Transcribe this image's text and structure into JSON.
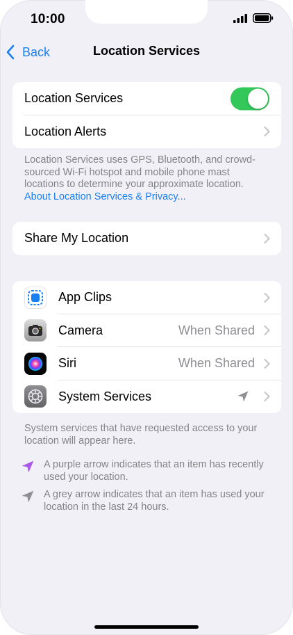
{
  "status_bar": {
    "time": "10:00"
  },
  "nav": {
    "back_label": "Back",
    "title": "Location Services"
  },
  "location_group": {
    "location_services_label": "Location Services",
    "location_services_enabled": true,
    "location_alerts_label": "Location Alerts"
  },
  "description": {
    "text": "Location Services uses GPS, Bluetooth, and crowd-sourced Wi-Fi hotspot and mobile phone mast locations to determine your approximate location.",
    "link": "About Location Services & Privacy..."
  },
  "share_group": {
    "share_my_location_label": "Share My Location"
  },
  "apps": [
    {
      "name": "App Clips",
      "value": "",
      "icon": "app-clips-icon"
    },
    {
      "name": "Camera",
      "value": "When Shared",
      "icon": "camera-icon"
    },
    {
      "name": "Siri",
      "value": "When Shared",
      "icon": "siri-icon"
    },
    {
      "name": "System Services",
      "value": "",
      "icon": "gear-icon",
      "status_icon": "location-arrow-grey-icon"
    }
  ],
  "system_note": "System services that have requested access to your location will appear here.",
  "legend": {
    "purple": "A purple arrow indicates that an item has recently used your location.",
    "grey": "A grey arrow indicates that an item has used your location in the last 24 hours."
  },
  "colors": {
    "accent": "#1a7ff0",
    "toggle_on": "#34c759",
    "background": "#f1f0f6",
    "purple_arrow": "#a958e6",
    "grey_arrow": "#8e8e93"
  }
}
